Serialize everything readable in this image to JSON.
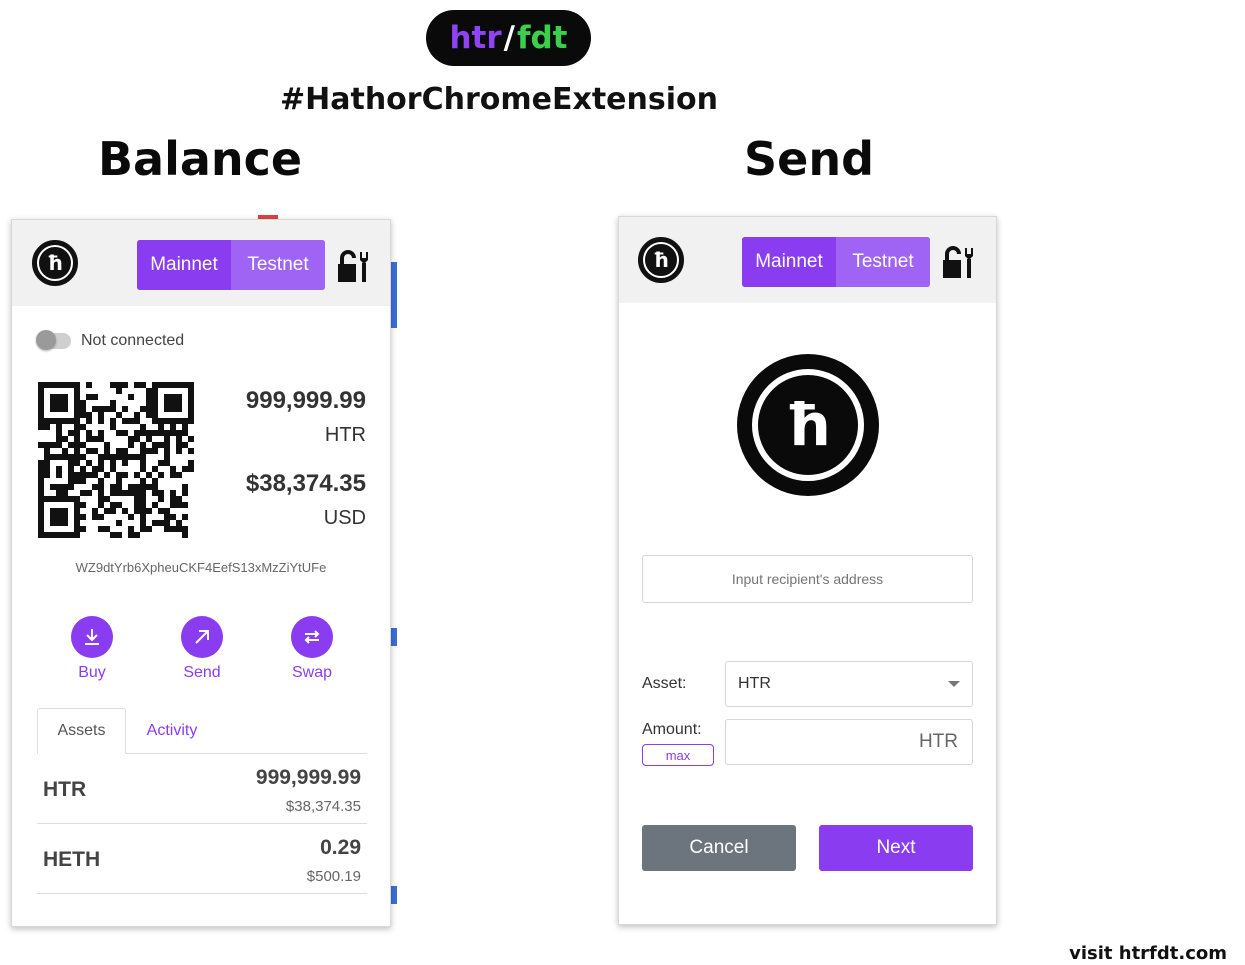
{
  "header": {
    "logo_left": "htr",
    "logo_sep": "/",
    "logo_right": "fdt",
    "hashtag": "#HathorChromeExtension",
    "balance_heading": "Balance",
    "send_heading": "Send",
    "footer": "visit htrfdt.com"
  },
  "colors": {
    "accent": "#8a3cf0",
    "accent_light": "#a064f5",
    "logo_purple": "#8e44f5",
    "logo_green": "#3ccf4e",
    "cancel_gray": "#6c757d"
  },
  "network": {
    "mainnet_label": "Mainnet",
    "testnet_label": "Testnet"
  },
  "balance_screen": {
    "connection_status": "Not connected",
    "htr_amount": "999,999.99",
    "htr_unit": "HTR",
    "usd_amount": "$38,374.35",
    "usd_unit": "USD",
    "address": "WZ9dtYrb6XpheuCKF4EefS13xMzZiYtUFe",
    "actions": {
      "buy": "Buy",
      "send": "Send",
      "swap": "Swap"
    },
    "tabs": {
      "assets": "Assets",
      "activity": "Activity"
    },
    "assets": [
      {
        "symbol": "HTR",
        "amount": "999,999.99",
        "usd": "$38,374.35"
      },
      {
        "symbol": "HETH",
        "amount": "0.29",
        "usd": "$500.19"
      }
    ]
  },
  "send_screen": {
    "recipient_placeholder": "Input recipient's address",
    "asset_label": "Asset:",
    "asset_value": "HTR",
    "amount_label": "Amount:",
    "amount_unit": "HTR",
    "max_label": "max",
    "cancel_label": "Cancel",
    "next_label": "Next"
  }
}
